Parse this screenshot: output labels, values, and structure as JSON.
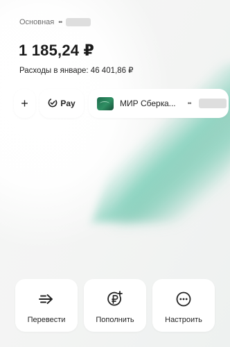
{
  "account": {
    "name": "Основная",
    "masked_dots": "••"
  },
  "balance": "1 185,24 ₽",
  "expenses": "Расходы в январе: 46 401,86 ₽",
  "quick_chips": {
    "add_symbol": "+",
    "pay_label": "Pay",
    "card_label": "МИР Сберкa...",
    "card_masked_dots": "••"
  },
  "actions": [
    {
      "label": "Перевести",
      "icon": "transfer-arrow-icon"
    },
    {
      "label": "Пополнить",
      "icon": "ruble-plus-icon"
    },
    {
      "label": "Настроить",
      "icon": "more-dots-icon"
    }
  ],
  "colors": {
    "accent_green": "#2f8f63",
    "sheen_green": "#4cbea0",
    "text": "#1f1f1f"
  }
}
